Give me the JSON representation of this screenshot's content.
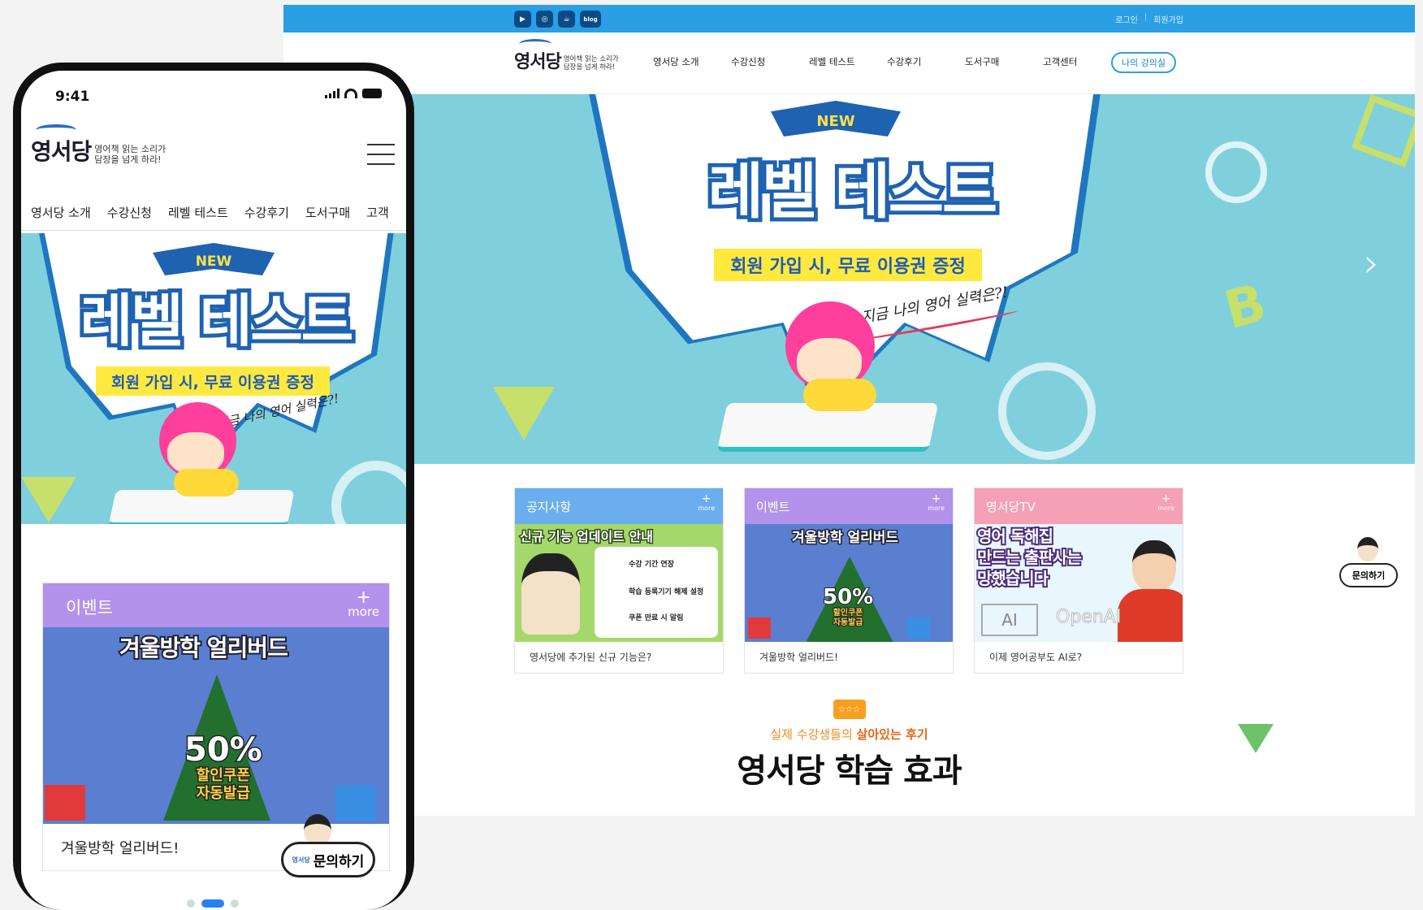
{
  "desktop": {
    "social": [
      "youtube-icon",
      "instagram-icon",
      "kakao-icon",
      "blog"
    ],
    "social_blog_label": "blog",
    "top_links": {
      "login": "로그인",
      "signup": "회원가입"
    },
    "logo": {
      "name": "영서당",
      "slogan_line1": "영어책 읽는 소리가",
      "slogan_line2": "담장을 넘게 하라!"
    },
    "menu": [
      "영서당 소개",
      "수강신청",
      "레벨 테스트",
      "수강후기",
      "도서구매",
      "고객센터"
    ],
    "my_class_button": "나의 강의실",
    "hero": {
      "badge": "NEW",
      "title": "레벨 테스트",
      "subtitle": "회원 가입 시, 무료 이용권 증정",
      "handwriting": "지금 나의 영어 실력은?!",
      "letter": "B",
      "next_arrow": "›"
    },
    "cards": [
      {
        "title": "공지사항",
        "more": "more",
        "plus": "+",
        "color": "#6aaef0",
        "image_title": "신규 기능 업데이트 안내",
        "image_rows": [
          "수강 기간 연장",
          "학습 등록기기 해제 설정",
          "쿠폰 만료 시 알림"
        ],
        "caption": "영서당에 추가된 신규 기능은?"
      },
      {
        "title": "이벤트",
        "more": "more",
        "plus": "+",
        "color": "#b292ea",
        "image_title": "겨울방학 얼리버드",
        "image_big": "50%",
        "image_small1": "할인쿠폰",
        "image_small2": "자동발급",
        "caption": "겨울방학 얼리버드!"
      },
      {
        "title": "영서당TV",
        "more": "more",
        "plus": "+",
        "color": "#f5a0b4",
        "image_title_line1": "영어 독해집",
        "image_title_line2": "만드는 출판사는",
        "image_title_line3": "망했습니다",
        "image_ai": "AI",
        "image_openai": "OpenAI",
        "caption": "이제 영어공부도 AI로?"
      }
    ],
    "effect": {
      "badge": "☆☆☆",
      "sub_prefix": "실제 수강생들의 ",
      "sub_highlight": "살아있는 후기",
      "title": "영서당 학습 효과"
    },
    "floating_ask": "문의하기"
  },
  "mobile": {
    "time": "9:41",
    "logo": {
      "name": "영서당",
      "slogan_line1": "영어책 읽는 소리가",
      "slogan_line2": "담장을 넘게 하라!"
    },
    "menu": [
      "영서당 소개",
      "수강신청",
      "레벨 테스트",
      "수강후기",
      "도서구매",
      "고객"
    ],
    "hero": {
      "badge": "NEW",
      "title": "레벨 테스트",
      "subtitle": "회원 가입 시, 무료 이용권 증정",
      "handwriting": "지금 나의 영어 실력은?!"
    },
    "card": {
      "title": "이벤트",
      "plus": "+",
      "more": "more",
      "image_title": "겨울방학 얼리버드",
      "image_big": "50%",
      "image_small1": "할인쿠폰",
      "image_small2": "자동발급",
      "caption": "겨울방학 얼리버드!"
    },
    "ask": {
      "brand": "영서당",
      "label": "문의하기"
    },
    "carousel_active_index": 1
  }
}
